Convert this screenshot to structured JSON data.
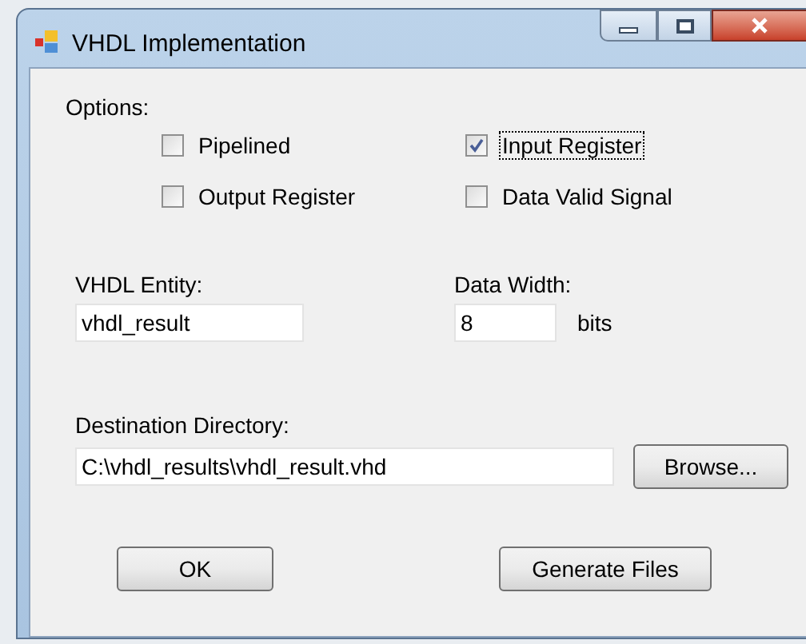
{
  "window": {
    "title": "VHDL Implementation"
  },
  "options": {
    "label": "Options:",
    "checkboxes": [
      {
        "label": "Pipelined",
        "checked": false,
        "focused": false
      },
      {
        "label": "Input Register",
        "checked": true,
        "focused": true
      },
      {
        "label": "Output Register",
        "checked": false,
        "focused": false
      },
      {
        "label": "Data Valid Signal",
        "checked": false,
        "focused": false
      }
    ]
  },
  "entity": {
    "label": "VHDL Entity:",
    "value": "vhdl_result"
  },
  "data_width": {
    "label": "Data Width:",
    "value": "8",
    "unit": "bits"
  },
  "destination": {
    "label": "Destination Directory:",
    "value": "C:\\vhdl_results\\vhdl_result.vhd",
    "browse": "Browse..."
  },
  "buttons": [
    "OK",
    "Generate Files"
  ]
}
